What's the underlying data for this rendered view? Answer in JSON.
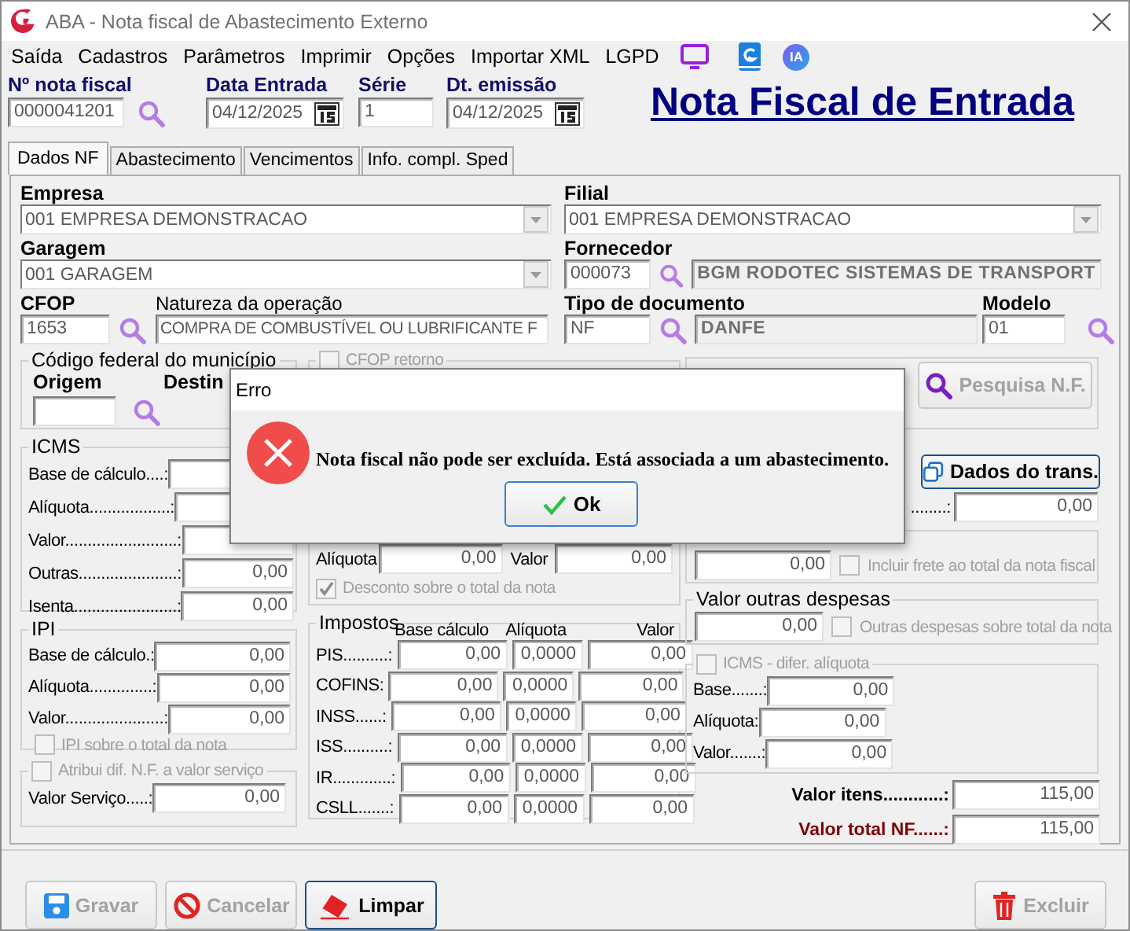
{
  "window": {
    "title": "ABA - Nota fiscal de Abastecimento Externo"
  },
  "menu": [
    "Saída",
    "Cadastros",
    "Parâmetros",
    "Imprimir",
    "Opções",
    "Importar XML",
    "LGPD"
  ],
  "menu_badge": "IA",
  "header": {
    "fields": [
      {
        "label": "Nº nota fiscal",
        "value": "0000041201",
        "kind": "search"
      },
      {
        "label": "Data Entrada",
        "value": "04/12/2025",
        "kind": "date"
      },
      {
        "label": "Série",
        "value": "1",
        "kind": "plain"
      },
      {
        "label": "Dt. emissão",
        "value": "04/12/2025",
        "kind": "date"
      }
    ],
    "heading": "Nota Fiscal de Entrada"
  },
  "tabs": [
    {
      "label": "Dados NF",
      "selected": true
    },
    {
      "label": "Abastecimento",
      "selected": false
    },
    {
      "label": "Vencimentos",
      "selected": false
    },
    {
      "label": "Info. compl. Sped",
      "selected": false
    }
  ],
  "empresa": {
    "label": "Empresa",
    "value": "001 EMPRESA DEMONSTRACAO"
  },
  "filial": {
    "label": "Filial",
    "value": "001 EMPRESA DEMONSTRACAO"
  },
  "garagem": {
    "label": "Garagem",
    "value": "001 GARAGEM"
  },
  "fornecedor": {
    "label": "Fornecedor",
    "code": "000073",
    "name": "BGM RODOTEC SISTEMAS DE TRANSPORT"
  },
  "cfop": {
    "label": "CFOP",
    "value": "1653"
  },
  "natureza": {
    "label": "Natureza da operação",
    "value": "COMPRA DE COMBUSTÍVEL OU LUBRIFICANTE F"
  },
  "tipo_documento": {
    "label": "Tipo de documento",
    "code": "NF",
    "name": "DANFE"
  },
  "modelo": {
    "label": "Modelo",
    "value": "01"
  },
  "municipio": {
    "title": "Código federal do município",
    "origem": "Origem",
    "destino": "Destin"
  },
  "cfop_retorno": {
    "label": "CFOP retorno",
    "checked": false,
    "disabled": true
  },
  "pesquisa_button": {
    "label": "Pesquisa N.F.",
    "disabled": true
  },
  "icms": {
    "title": "ICMS",
    "rows": [
      {
        "label": "Base de cálculo....:"
      },
      {
        "label": "Alíquota..................:"
      },
      {
        "label": "Valor.........................:"
      },
      {
        "label": "Outras......................:",
        "value": "0,00"
      },
      {
        "label": "Isenta.......................:",
        "value": "0,00"
      }
    ]
  },
  "desconto": {
    "aliquota_label": "Alíquota",
    "aliquota": "0,00",
    "valor_label": "Valor",
    "valor": "0,00",
    "checkbox": {
      "label": "Desconto sobre o total da nota",
      "checked": true,
      "disabled": true
    }
  },
  "ipi": {
    "title": "IPI",
    "rows": [
      {
        "label": "Base de cálculo.:",
        "value": "0,00"
      },
      {
        "label": "Alíquota..............:",
        "value": "0,00"
      },
      {
        "label": "Valor......................:",
        "value": "0,00"
      }
    ],
    "checkbox": {
      "label": "IPI sobre o total da nota",
      "checked": false,
      "disabled": true
    }
  },
  "servico": {
    "checkbox": {
      "label": "Atribui dif. N.F. a valor serviço",
      "checked": false,
      "disabled": true
    },
    "label": "Valor Serviço.....:",
    "value": "0,00"
  },
  "impostos": {
    "title": "Impostos",
    "columns": [
      "Base cálculo",
      "Alíquota",
      "Valor"
    ],
    "rows": [
      {
        "label": "PIS..........:",
        "values": [
          "0,00",
          "0,0000",
          "0,00"
        ]
      },
      {
        "label": "COFINS:",
        "values": [
          "0,00",
          "0,0000",
          "0,00"
        ]
      },
      {
        "label": "INSS......:",
        "values": [
          "0,00",
          "0,0000",
          "0,00"
        ]
      },
      {
        "label": "ISS..........:",
        "values": [
          "0,00",
          "0,0000",
          "0,00"
        ]
      },
      {
        "label": "IR.............:",
        "values": [
          "0,00",
          "0,0000",
          "0,00"
        ]
      },
      {
        "label": "CSLL.......:",
        "values": [
          "0,00",
          "0,0000",
          "0,00"
        ]
      }
    ]
  },
  "dados_trans_button": {
    "label": "Dados do trans.",
    "disabled": false
  },
  "frete": {
    "label": "........:",
    "value": "0,00",
    "frete_value": "0,00",
    "checkbox": {
      "label": "Incluir frete ao total da nota fiscal",
      "checked": false,
      "disabled": true
    }
  },
  "outras_despesas": {
    "title": "Valor outras despesas",
    "value": "0,00",
    "checkbox": {
      "label": "Outras despesas sobre total da nota",
      "checked": false,
      "disabled": true
    }
  },
  "icms_difer": {
    "checkbox": {
      "label": "ICMS - difer. alíquota",
      "checked": false,
      "disabled": true
    },
    "rows": [
      {
        "label": "Base.......:",
        "value": "0,00"
      },
      {
        "label": "Alíquota:",
        "value": "0,00"
      },
      {
        "label": "Valor.......:",
        "value": "0,00"
      }
    ]
  },
  "totals": [
    {
      "label": "Valor itens............:",
      "value": "115,00",
      "kind": "items"
    },
    {
      "label": "Valor total NF......:",
      "value": "115,00",
      "kind": "total"
    }
  ],
  "buttons": [
    {
      "label": "Gravar",
      "kind": "save",
      "disabled": true,
      "focused": false
    },
    {
      "label": "Cancelar",
      "kind": "cancel",
      "disabled": true,
      "focused": false
    },
    {
      "label": "Limpar",
      "kind": "clear",
      "disabled": false,
      "focused": true
    },
    {
      "label": "Excluir",
      "kind": "delete",
      "disabled": true,
      "focused": false
    }
  ],
  "dialog": {
    "title": "Erro",
    "message": "Nota fiscal não pode ser excluída. Está associada a um abastecimento.",
    "button": "Ok"
  }
}
